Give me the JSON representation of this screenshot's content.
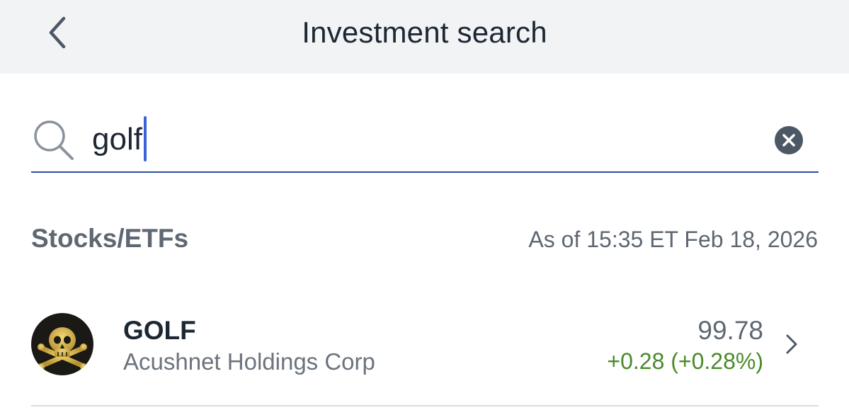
{
  "header": {
    "title": "Investment search",
    "back_icon": "chevron-left-icon"
  },
  "search": {
    "value": "golf",
    "placeholder": "",
    "search_icon": "search-icon",
    "clear_icon": "close-circle-icon",
    "accent_color": "#2b4f9e"
  },
  "section": {
    "label": "Stocks/ETFs",
    "timestamp": "As of 15:35 ET Feb 18, 2026"
  },
  "results": [
    {
      "ticker": "GOLF",
      "company": "Acushnet Holdings Corp",
      "price": "99.78",
      "change": "+0.28 (+0.28%)",
      "change_color": "#4a8a2a",
      "avatar_icon": "skull-crossbones-icon",
      "chevron_icon": "chevron-right-icon"
    }
  ]
}
